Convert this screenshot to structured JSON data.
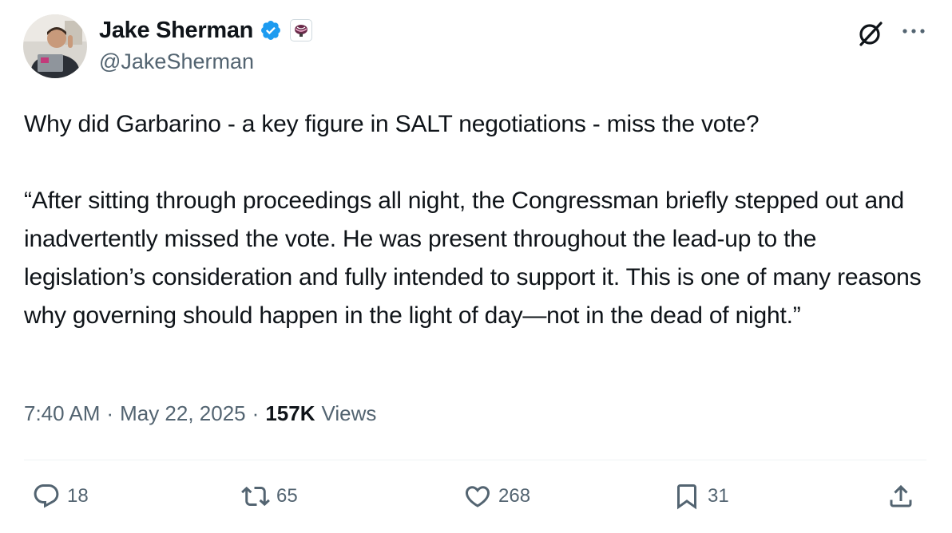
{
  "tweet": {
    "author": {
      "name": "Jake Sherman",
      "handle": "@JakeSherman",
      "verified": true,
      "avatar": "person-portrait",
      "affiliation_badge": "organization-badge"
    },
    "text": {
      "p1": "Why did Garbarino - a key figure in SALT negotiations - miss the vote?",
      "p2": "“After sitting through proceedings all night, the Congressman briefly stepped out and inadvertently missed the vote. He was present throughout the lead-up to the legislation’s consideration and fully intended to support it. This is one of many reasons why governing should happen in the light of day—not in the dead of night.”"
    },
    "time": "7:40 AM",
    "date": "May 22, 2025",
    "separator": "·",
    "views_count": "157K",
    "views_label": "Views"
  },
  "actions": {
    "replies": "18",
    "reposts": "65",
    "likes": "268",
    "bookmarks": "31"
  },
  "colors": {
    "text": "#0f1419",
    "secondary": "#536471",
    "verified": "#1d9bf0",
    "divider": "#eff3f4"
  }
}
